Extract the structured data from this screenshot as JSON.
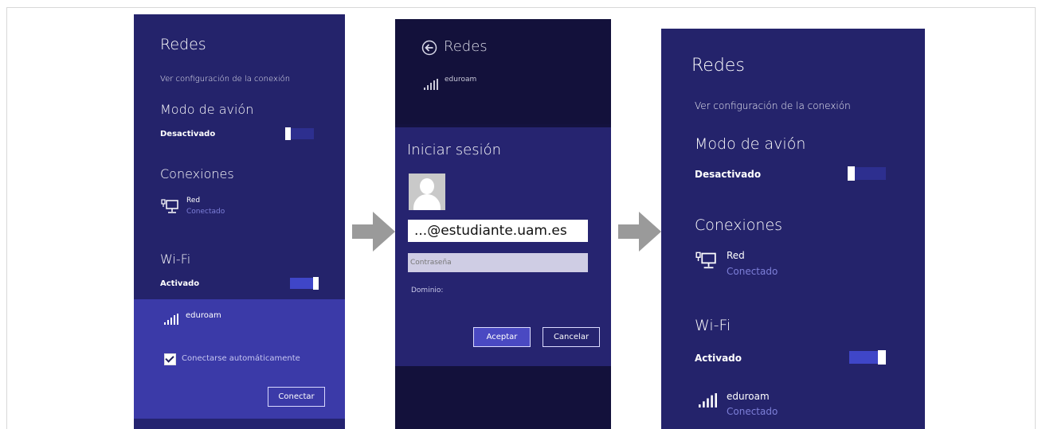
{
  "panel1": {
    "title": "Redes",
    "link": "Ver configuración de la conexión",
    "airplane": {
      "heading": "Modo de avión",
      "status": "Desactivado"
    },
    "connections": {
      "heading": "Conexiones",
      "name": "Red",
      "status": "Conectado"
    },
    "wifi": {
      "heading": "Wi-Fi",
      "status": "Activado",
      "network": "eduroam",
      "auto_connect": "Conectarse automáticamente",
      "connect_button": "Conectar"
    }
  },
  "panel2": {
    "title": "Redes",
    "network": "eduroam",
    "dialog_title": "Iniciar sesión",
    "username": "...@estudiante.uam.es",
    "password_placeholder": "Contraseña",
    "domain_label": "Dominio:",
    "accept_button": "Aceptar",
    "cancel_button": "Cancelar"
  },
  "panel3": {
    "title": "Redes",
    "link": "Ver configuración de la conexión",
    "airplane": {
      "heading": "Modo de avión",
      "status": "Desactivado"
    },
    "connections": {
      "heading": "Conexiones",
      "name": "Red",
      "status": "Conectado"
    },
    "wifi": {
      "heading": "Wi-Fi",
      "status": "Activado",
      "network": "eduroam",
      "network_status": "Conectado"
    }
  },
  "colors": {
    "panel": "#24236b",
    "accent": "#3f46c8",
    "muted": "#7d7fd8"
  }
}
